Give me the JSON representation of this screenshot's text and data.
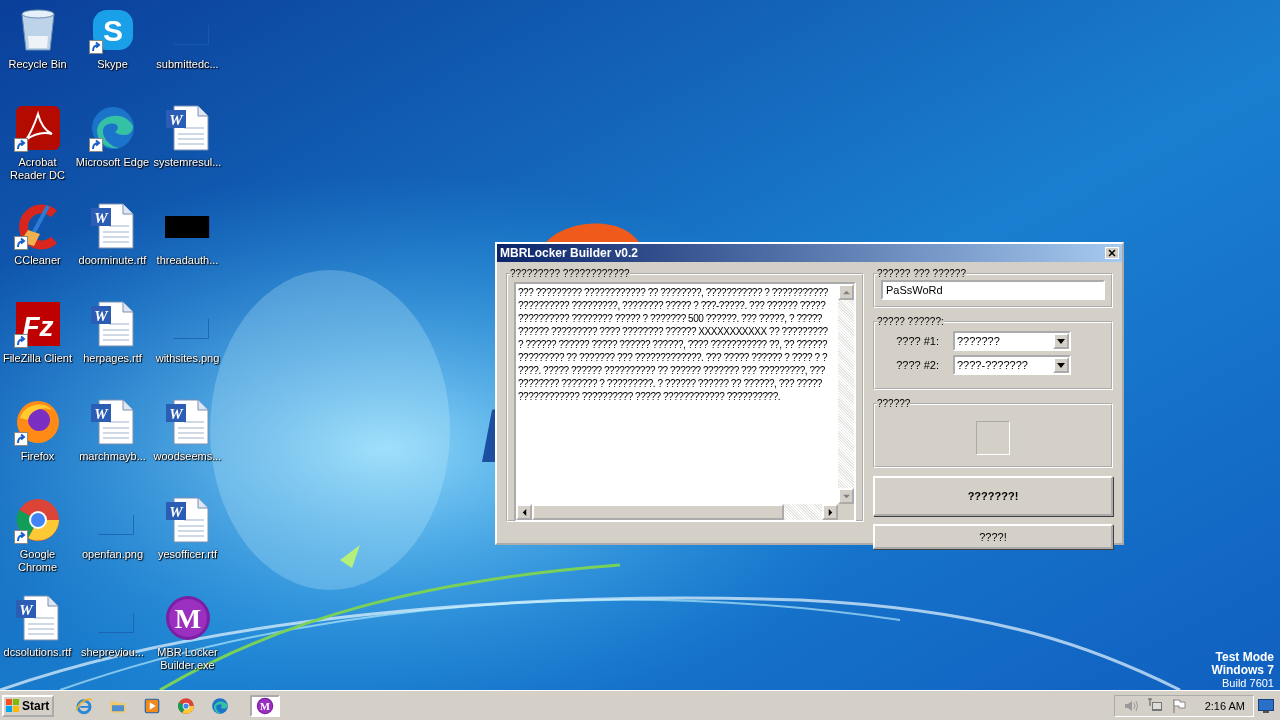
{
  "desktop": {
    "icons": [
      {
        "label": "Recycle Bin",
        "kind": "recycle",
        "shortcut": false
      },
      {
        "label": "Acrobat Reader DC",
        "kind": "acrobat",
        "shortcut": true
      },
      {
        "label": "CCleaner",
        "kind": "ccleaner",
        "shortcut": true
      },
      {
        "label": "FileZilla Client",
        "kind": "filezilla",
        "glyph": "Fz",
        "shortcut": true
      },
      {
        "label": "Firefox",
        "kind": "firefox",
        "shortcut": true
      },
      {
        "label": "Google Chrome",
        "kind": "chrome",
        "shortcut": true
      },
      {
        "label": "dcsolutions.rtf",
        "kind": "word",
        "glyph": "W",
        "shortcut": false
      },
      {
        "label": "Skype",
        "kind": "skype",
        "glyph": "S",
        "shortcut": true
      },
      {
        "label": "Microsoft Edge",
        "kind": "edge",
        "shortcut": true
      },
      {
        "label": "doorminute.rtf",
        "kind": "word",
        "glyph": "W",
        "shortcut": false
      },
      {
        "label": "herpages.rtf",
        "kind": "word",
        "glyph": "W",
        "shortcut": false
      },
      {
        "label": "marchmayb...",
        "kind": "word",
        "glyph": "W",
        "shortcut": false
      },
      {
        "label": "openfan.png",
        "kind": "blank",
        "shortcut": false
      },
      {
        "label": "shepreviou...",
        "kind": "blank",
        "shortcut": false
      },
      {
        "label": "submittedc...",
        "kind": "blank",
        "shortcut": false
      },
      {
        "label": "systemresul...",
        "kind": "word",
        "glyph": "W",
        "shortcut": false
      },
      {
        "label": "threadauth...",
        "kind": "dark",
        "shortcut": false
      },
      {
        "label": "withsites.png",
        "kind": "blank",
        "shortcut": false
      },
      {
        "label": "woodseems...",
        "kind": "word",
        "glyph": "W",
        "shortcut": false
      },
      {
        "label": "yesofficer.rtf",
        "kind": "word",
        "glyph": "W",
        "shortcut": false
      },
      {
        "label": "MBR Locker Builder.exe",
        "kind": "mbr",
        "glyph": "M",
        "shortcut": false
      }
    ],
    "system_notice": [
      "Test Mode",
      "Windows 7",
      "Build 7601"
    ]
  },
  "window": {
    "title": "MBRLocker Builder v0.2",
    "message_group": {
      "label": "????????? ????????????",
      "lines": [
        "??? ????????? ???????????? ?? ????????, ??????????? ? ???????????",
        "?????????? ?????????, ???????? ????? ? ???-?????. ??? ?????? ?????",
        "?????????? ???????? ????? ? ??????? 500 ??????. ??? ?????, ? ?????",
        "?????? ????????? ???? ???????? ?????? XXXXXXXXXXX ?? ?????????",
        "? ?????? ?????? ????? ?????? ??????, ???? ??????????? ??, ?? ??????",
        "????????? ?? ??????? ??? ?????????????. ??? ????? ?????? ? ???? ? ?",
        "????. ????? ?????? ?????????? ?? ?????? ??????? ??? ?????????, ???",
        "???????? ??????? ? ?????????. ? ?????? ?????? ?? ??????, ??? ?????",
        "???????????? ?????????? ????? ???????????? ??????????."
      ]
    },
    "password_group": {
      "label": "?????? ??? ??????",
      "value": "PaSsWoRd"
    },
    "options_group": {
      "label": "????? ??????:",
      "fields": [
        {
          "label": "???? #1:",
          "value": "???????"
        },
        {
          "label": "???? #2:",
          "value": "????-???????"
        }
      ]
    },
    "icon_group": {
      "label": "??????"
    },
    "buttons": [
      {
        "label": "???????!",
        "kind": "primary"
      },
      {
        "label": "????!",
        "kind": "secondary"
      }
    ]
  },
  "taskbar": {
    "start": "Start",
    "apps": [
      {
        "kind": "ie",
        "active": false
      },
      {
        "kind": "folder",
        "active": false
      },
      {
        "kind": "media",
        "active": false
      },
      {
        "kind": "chrome",
        "active": false
      },
      {
        "kind": "edge",
        "active": false
      },
      {
        "kind": "mbr",
        "glyph": "M",
        "active": true
      }
    ],
    "tray": {
      "time": "2:16 AM"
    }
  }
}
